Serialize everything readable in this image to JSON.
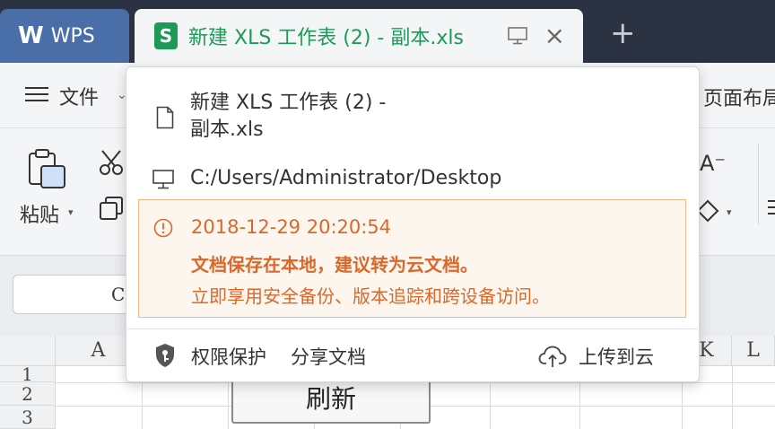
{
  "tabbar": {
    "app_tab_label": "WPS",
    "doc_tab_icon_text": "S",
    "doc_tab_title": "新建 XLS 工作表 (2) - 副本.xls",
    "new_tab_symbol": "+"
  },
  "menubar": {
    "file_label": "文件",
    "file_caret": "⌄",
    "right_partial_label": "页面布局"
  },
  "toolbar": {
    "paste_label": "粘贴",
    "paste_caret": "▾",
    "font_size_label": "A⁻",
    "eraser_caret": "▾"
  },
  "formula": {
    "name_box_partial": "C"
  },
  "sheet": {
    "columns": [
      "A",
      "K",
      "L"
    ],
    "rows": [
      "1",
      "2",
      "3"
    ],
    "button_label": "刷新"
  },
  "popover": {
    "file_name": "新建 XLS 工作表 (2) - 副本.xls",
    "file_name_line1": "新建 XLS 工作表 (2) -",
    "file_name_line2": "副本.xls",
    "path": "C:/Users/Administrator/Desktop",
    "warning": {
      "timestamp": "2018-12-29 20:20:54",
      "title": "文档保存在本地，建议转为云文档。",
      "description": "立即享用安全备份、版本追踪和跨设备访问。"
    },
    "actions": {
      "permission": "权限保护",
      "share": "分享文档",
      "upload": "上传到云"
    }
  },
  "colors": {
    "tabbar_bg": "#2b3242",
    "wps_tab_bg": "#4a6fa8",
    "xls_green": "#1e9a58",
    "warning_orange": "#d9682b",
    "warning_border": "#f2b986",
    "warning_bg": "#fdf6ef"
  },
  "icons": {
    "file": "document-icon",
    "location": "monitor-icon",
    "warning": "info-circle-icon",
    "permission": "shield-key-icon",
    "upload": "cloud-upload-icon"
  }
}
